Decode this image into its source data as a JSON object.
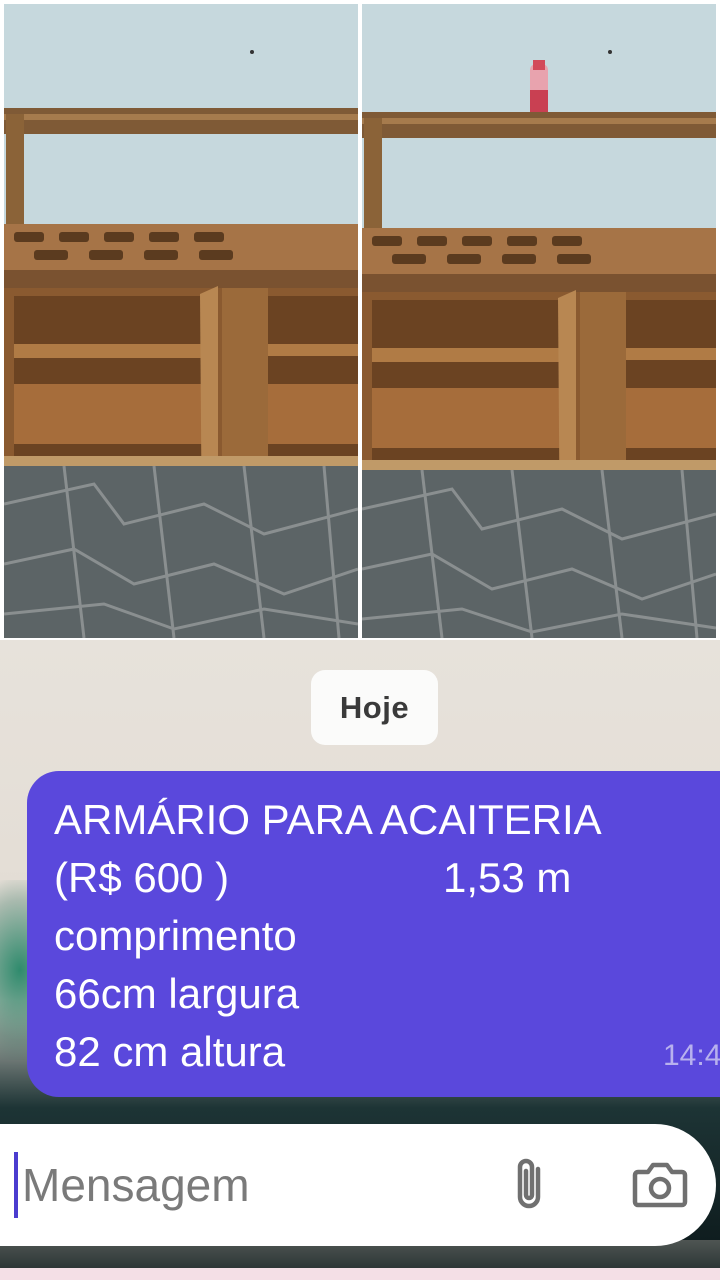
{
  "chat": {
    "date_label": "Hoje",
    "message": {
      "line1": "ARMÁRIO PARA ACAITERIA",
      "line2_left": "(R$ 600  )",
      "line2_right": "1,53 m",
      "line3": "comprimento",
      "line4": "66cm largura",
      "line5": "82 cm  altura",
      "time": "14:4"
    }
  },
  "composer": {
    "placeholder": "Mensagem",
    "attach_icon": "paperclip-icon",
    "camera_icon": "camera-icon"
  },
  "colors": {
    "bubble": "#5a48dc",
    "wall": "#c4d7dc",
    "wood": "#9a6a3a"
  }
}
